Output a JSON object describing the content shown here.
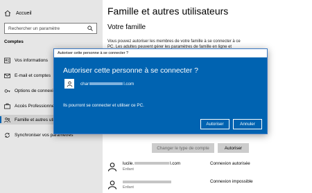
{
  "sidebar": {
    "home_label": "Accueil",
    "search_placeholder": "Rechercher un paramètre",
    "section_label": "Comptes",
    "items": [
      {
        "label": "Vos informations",
        "icon": "person-card-icon"
      },
      {
        "label": "E-mail et comptes",
        "icon": "mail-icon"
      },
      {
        "label": "Options de connexion",
        "icon": "key-icon"
      },
      {
        "label": "Accès Professionnel ou scolaire",
        "icon": "briefcase-icon"
      },
      {
        "label": "Famille et autres utilisateurs",
        "icon": "people-icon"
      },
      {
        "label": "Synchroniser vos paramètres",
        "icon": "sync-icon"
      }
    ]
  },
  "main": {
    "title": "Famille et autres utilisateurs",
    "subheading": "Votre famille",
    "description_line1": "Vous pouvez autoriser les membres de votre famille à se connecter à ce",
    "description_line2": "PC. Les adultes peuvent gérer les paramètres de famille en ligne et",
    "change_type_label": "Changer le type de compte",
    "authorize_label": "Autoriser",
    "members": [
      {
        "name_prefix": "lucile.",
        "name_suffix": "l.com",
        "role": "Enfant",
        "status": "Connexion autorisée"
      },
      {
        "role": "Enfant",
        "status": "Connexion impossible"
      }
    ]
  },
  "dialog": {
    "titlebar": "Autoriser cette personne à se connecter ?",
    "heading": "Autoriser cette personne à se connecter ?",
    "email_prefix": "char",
    "email_suffix": "l.com",
    "message": "Ils pourront se connecter et utiliser ce PC.",
    "primary_button": "Autoriser",
    "secondary_button": "Annuler"
  },
  "colors": {
    "accent": "#0063b1",
    "sidebar_bg": "#e6e6e6"
  }
}
